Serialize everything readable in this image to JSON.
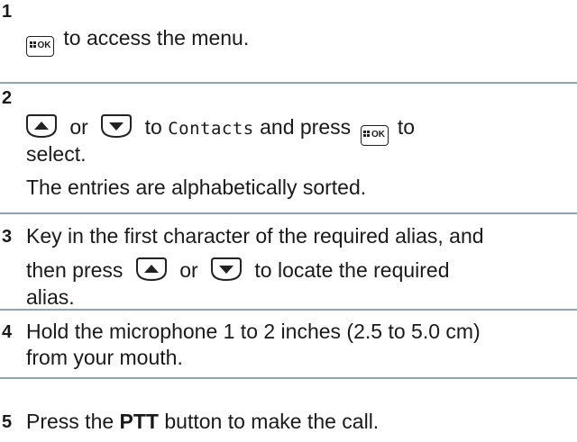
{
  "steps": [
    {
      "number": "1",
      "line1_after_key": "to access the menu."
    },
    {
      "number": "2",
      "or": "or",
      "to": "to",
      "menu_item": "Contacts",
      "and_press": "and press",
      "to2": "to",
      "line2": "select.",
      "note": "The entries are alphabetically sorted."
    },
    {
      "number": "3",
      "line1": "Key in the first character of the required alias, and",
      "then_press": "then press",
      "or": "or",
      "to_locate": "to locate the required",
      "line3": "alias."
    },
    {
      "number": "4",
      "line1": "Hold the microphone 1 to 2 inches (2.5 to 5.0 cm)",
      "line2": "from your mouth."
    },
    {
      "number": "5",
      "press": "Press the",
      "button_name": "PTT",
      "rest": "button to make the call."
    }
  ],
  "keys": {
    "ok_label": "OK",
    "icons": [
      "menu-ok-key-icon",
      "up-arrow-key-icon",
      "down-arrow-key-icon"
    ]
  },
  "colors": {
    "divider": "#8ea3b4",
    "text": "#1a1a1a"
  }
}
